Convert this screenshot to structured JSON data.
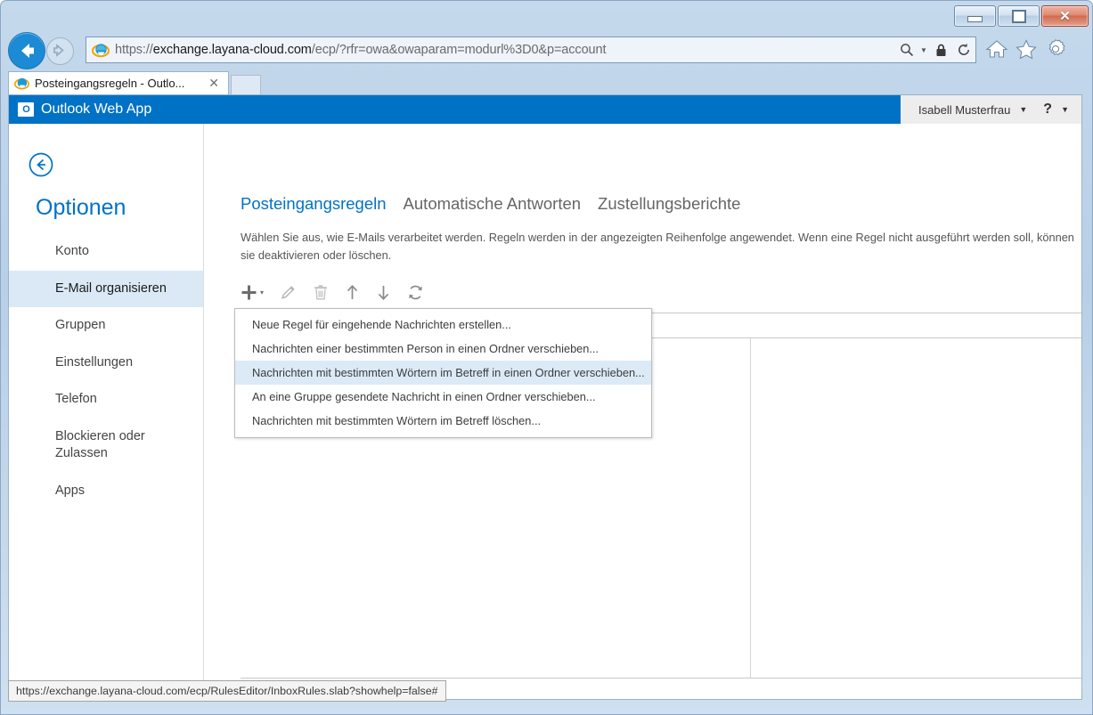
{
  "window": {
    "controls": {
      "minimize_label": "Minimieren",
      "maximize_label": "Maximieren",
      "close_label": "✕"
    }
  },
  "browser": {
    "url_prefix": "https://",
    "url_host": "exchange.layana-cloud.com",
    "url_path": "/ecp/?rfr=owa&owaparam=modurl%3D0&p=account",
    "url_full": "https://exchange.layana-cloud.com/ecp/?rfr=owa&owaparam=modurl%3D0&p=account",
    "back_label": "Zurück",
    "forward_label": "Vorwärts",
    "search_icon": "search-icon",
    "lock_icon": "lock-icon",
    "refresh_icon": "refresh-icon",
    "home_icon": "home-icon",
    "favorites_icon": "star-icon",
    "tools_icon": "gear-icon",
    "tab": {
      "title": "Posteingangsregeln - Outlo...",
      "close_label": "✕"
    }
  },
  "owa": {
    "logo_text": "O",
    "app_title": "Outlook Web App",
    "user_name": "Isabell Musterfrau",
    "user_caret": "▼",
    "help_label": "?",
    "help_caret": "▼"
  },
  "sidebar": {
    "back_icon": "back-arrow-circle-icon",
    "heading": "Optionen",
    "items": [
      {
        "label": "Konto",
        "selected": false
      },
      {
        "label": "E-Mail organisieren",
        "selected": true
      },
      {
        "label": "Gruppen",
        "selected": false
      },
      {
        "label": "Einstellungen",
        "selected": false
      },
      {
        "label": "Telefon",
        "selected": false
      },
      {
        "label": "Blockieren oder Zulassen",
        "selected": false
      },
      {
        "label": "Apps",
        "selected": false
      }
    ]
  },
  "main": {
    "tabs": [
      {
        "label": "Posteingangsregeln",
        "active": true
      },
      {
        "label": "Automatische Antworten",
        "active": false
      },
      {
        "label": "Zustellungsberichte",
        "active": false
      }
    ],
    "description": "Wählen Sie aus, wie E-Mails verarbeitet werden. Regeln werden in der angezeigten Reihenfolge angewendet. Wenn eine Regel nicht ausgeführt werden soll, können sie deaktivieren oder löschen.",
    "toolbar": [
      {
        "name": "new-rule-button",
        "glyph": "plus-icon",
        "caret": "▾",
        "enabled": true
      },
      {
        "name": "edit-button",
        "glyph": "pencil-icon",
        "enabled": false
      },
      {
        "name": "delete-button",
        "glyph": "trash-icon",
        "enabled": false
      },
      {
        "name": "move-up-button",
        "glyph": "arrow-up-icon",
        "enabled": true
      },
      {
        "name": "move-down-button",
        "glyph": "arrow-down-icon",
        "enabled": true
      },
      {
        "name": "refresh-button",
        "glyph": "refresh-icon",
        "enabled": true
      }
    ]
  },
  "new_rule_menu": {
    "items": [
      {
        "label": "Neue Regel für eingehende Nachrichten erstellen...",
        "hover": false
      },
      {
        "label": "Nachrichten einer bestimmten Person in einen Ordner verschieben...",
        "hover": false
      },
      {
        "label": "Nachrichten mit bestimmten Wörtern im Betreff in einen Ordner verschieben...",
        "hover": true
      },
      {
        "label": "An eine Gruppe gesendete Nachricht in einen Ordner verschieben...",
        "hover": false
      },
      {
        "label": "Nachrichten mit bestimmten Wörtern im Betreff löschen...",
        "hover": false
      }
    ]
  },
  "statusbar": {
    "link_url": "https://exchange.layana-cloud.com/ecp/RulesEditor/InboxRules.slab?showhelp=false#"
  },
  "colors": {
    "accent_blue": "#0072c6",
    "nav_selected_bg": "#dbe9f7",
    "menu_hover_bg": "#dceaf7",
    "frame_blue": "#b8cfe6"
  }
}
